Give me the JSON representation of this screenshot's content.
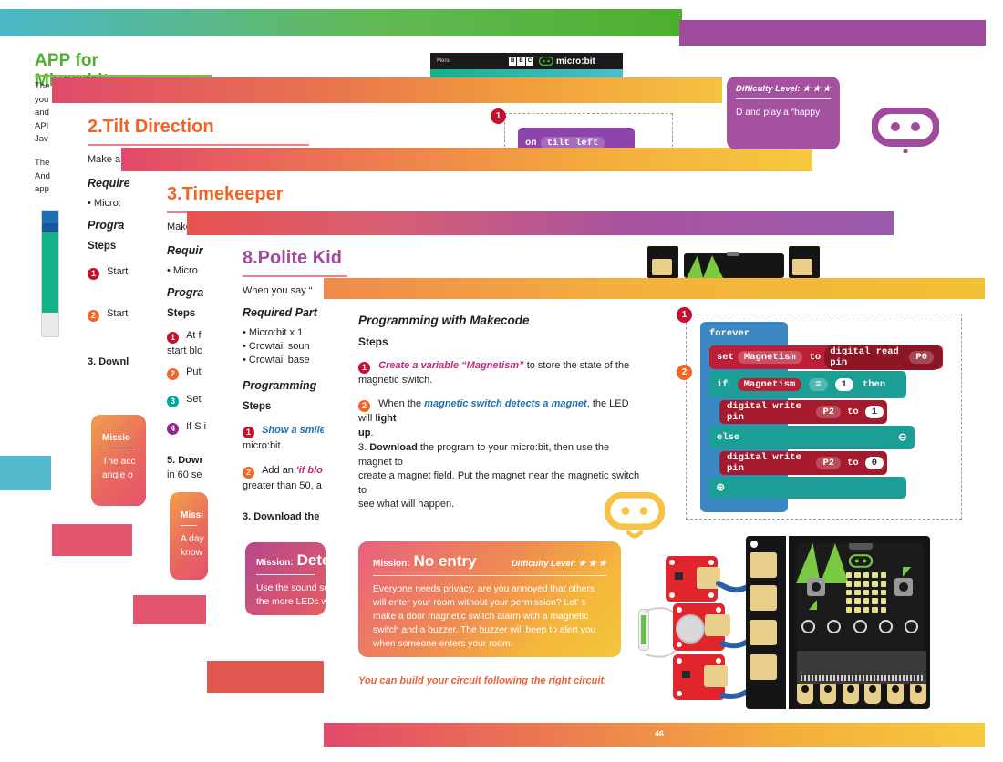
{
  "page": {
    "number": "46"
  },
  "topbars": {
    "teal_green": "teal-green-gradient-bar",
    "purple": "purple-bar"
  },
  "microbit_header": {
    "menu": "Menu",
    "bbc": [
      "B",
      "B",
      "C"
    ],
    "brand": "micro:bit"
  },
  "left_column": {
    "title": "APP for Micro:bit",
    "para1": [
      "The",
      "you",
      "and",
      "API",
      "Jav"
    ],
    "para2": [
      "The",
      "And",
      "app"
    ]
  },
  "section_tilt": {
    "title": "2.Tilt Direction",
    "intro": "Make a t",
    "required_label": "Require",
    "bullet1": "Micro:",
    "programming_label": "Progra",
    "steps_label": "Steps",
    "steps": [
      {
        "n": "1",
        "text": "Start"
      },
      {
        "n": "2",
        "text": "Start"
      }
    ],
    "step3": "3. Downl",
    "code_block": {
      "on": "on",
      "value": "tilt left"
    },
    "badge": "1"
  },
  "section_timekeeper": {
    "title": "3.Timekeeper",
    "intro": "Make a",
    "required_label": "Requir",
    "bullet1": "Micro",
    "programming_label": "Progra",
    "steps_label": "Steps",
    "steps": [
      {
        "n": "1",
        "text": "At f",
        "cont": "start blc"
      },
      {
        "n": "2",
        "text": "Put"
      },
      {
        "n": "3",
        "text": "Set"
      },
      {
        "n": "4",
        "text": "If S i"
      }
    ],
    "step5": "5. Dowr",
    "step5_cont": "in 60 se"
  },
  "section_polite": {
    "title": "8.Polite Kid",
    "intro": "When you say “",
    "required_label": "Required Part",
    "bullets": [
      "Micro:bit x 1",
      "Crowtail soun",
      "Crowtail base"
    ],
    "programming_label": "Programming",
    "steps_label": "Steps",
    "steps": [
      {
        "n": "1",
        "link": "Show a smile",
        "cont": "micro:bit."
      },
      {
        "n": "2",
        "pre": "Add an ",
        "link": "'if blo",
        "cont": "greater than 50, a"
      }
    ],
    "step3": "3. Download the"
  },
  "section_magnet": {
    "programming_title": "Programming with Makecode",
    "steps_label": "Steps",
    "step1": {
      "n": "1",
      "link": "Create a variable “Magnetism”",
      "rest": " to store the state of the",
      "line2": "magnetic switch."
    },
    "step2": {
      "n": "2",
      "pre": "When the ",
      "link": "magnetic switch detects a magnet",
      "mid": ", the LED will ",
      "bold": "light",
      "line2_bold": "up",
      "line2_rest": "."
    },
    "step3": {
      "lead": "3. ",
      "bold": "Download",
      "rest": " the program to your micro:bit, then use the magnet to",
      "line2": "create a magnet field. Put the magnet near the magnetic switch to",
      "line3": "see what will happen."
    },
    "caption": "You can build your circuit following the right circuit."
  },
  "makecode": {
    "badges": [
      "1",
      "2"
    ],
    "forever": "forever",
    "row_set": {
      "set": "set",
      "var": "Magnetism",
      "to": "to",
      "read": "digital read pin",
      "pin": "P0"
    },
    "row_if": {
      "if": "if",
      "var": "Magnetism",
      "op": "=",
      "val": "1",
      "then": "then"
    },
    "row_write1": {
      "label": "digital write pin",
      "pin": "P2",
      "to": "to",
      "val": "1"
    },
    "row_else": {
      "else": "else",
      "minus": "⊖"
    },
    "row_write2": {
      "label": "digital write pin",
      "pin": "P2",
      "to": "to",
      "val": "0"
    },
    "plus": "⊕"
  },
  "missions": {
    "no_entry": {
      "label": "Mission:",
      "title": "No entry",
      "difficulty_label": "Difficulty Level:",
      "stars": "★ ★ ★",
      "body": "Everyone needs privacy, are you annoyed that others will enter your room without your permission? Let’ s make a door magnetic switch alarm with a magnetic switch and a buzzer. The buzzer will beep to alert you when someone enters your room."
    },
    "detect": {
      "label": "Mission:",
      "title": "Detec",
      "line1": "Use the sound se",
      "line2": "the more LEDs w"
    },
    "accel": {
      "label": "Missio",
      "line1": "The acc",
      "line2": "angle o"
    },
    "day": {
      "label": "Missi",
      "line1": "A day",
      "line2": "know"
    },
    "happy": {
      "difficulty_label": "Difficulty Level:",
      "stars": "★ ★ ★",
      "body": "D and play a “happy"
    }
  },
  "icons": {
    "robot_purple": "robot-face-icon",
    "robot_yellow": "robot-face-icon"
  },
  "colors": {
    "green": "#4caf2e",
    "orange": "#f26222",
    "purple": "#a04a9e",
    "crimson": "#c8102e",
    "teal": "#00a79d",
    "blue_link": "#1f6fb4",
    "magenta_link": "#c2267c"
  }
}
